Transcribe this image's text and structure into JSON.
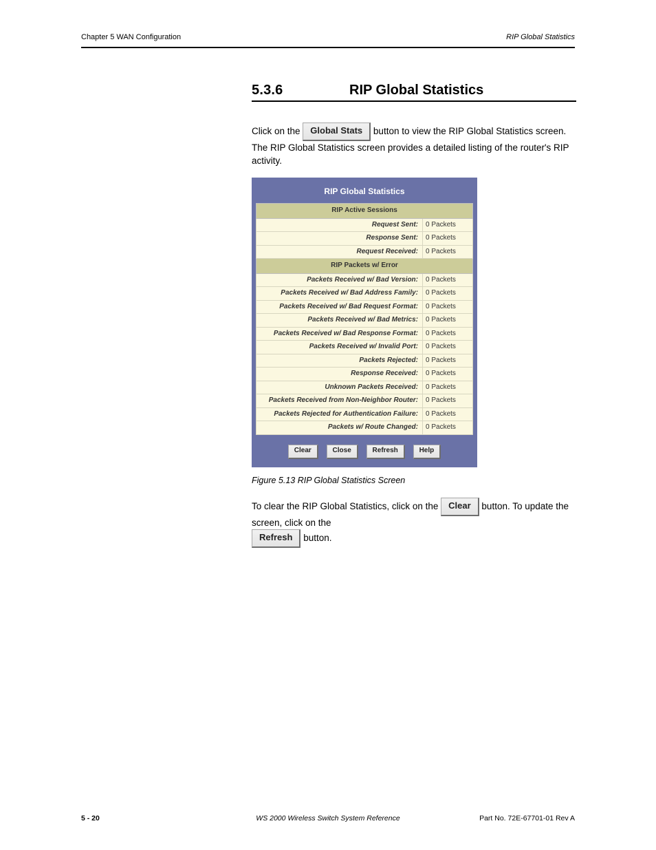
{
  "header": {
    "left": "Chapter 5    WAN Configuration",
    "right": "RIP Global Statistics"
  },
  "section": {
    "number": "5.3.6",
    "title": "RIP Global Statistics"
  },
  "para1_prefix": "Click on the ",
  "para1_btn": "Global Stats",
  "para1_suffix": " button to view the RIP Global Statistics screen. The RIP Global Statistics screen provides a detailed listing of the router's RIP activity.",
  "panel": {
    "title": "RIP Global Statistics",
    "section1": "RIP Active Sessions",
    "rows1": [
      {
        "label": "Request Sent:",
        "value": "0 Packets"
      },
      {
        "label": "Response Sent:",
        "value": "0 Packets"
      },
      {
        "label": "Request Received:",
        "value": "0 Packets"
      }
    ],
    "section2": "RIP Packets w/ Error",
    "rows2": [
      {
        "label": "Packets Received w/ Bad Version:",
        "value": "0 Packets"
      },
      {
        "label": "Packets Received w/ Bad Address Family:",
        "value": "0 Packets"
      },
      {
        "label": "Packets Received w/ Bad Request Format:",
        "value": "0 Packets"
      },
      {
        "label": "Packets Received w/ Bad Metrics:",
        "value": "0 Packets"
      },
      {
        "label": "Packets Received w/ Bad Response Format:",
        "value": "0 Packets"
      },
      {
        "label": "Packets Received w/ Invalid Port:",
        "value": "0 Packets"
      },
      {
        "label": "Packets Rejected:",
        "value": "0 Packets"
      },
      {
        "label": "Response Received:",
        "value": "0 Packets"
      },
      {
        "label": "Unknown Packets Received:",
        "value": "0 Packets"
      },
      {
        "label": "Packets Received from Non-Neighbor Router:",
        "value": "0 Packets"
      },
      {
        "label": "Packets Rejected for Authentication Failure:",
        "value": "0 Packets"
      },
      {
        "label": "Packets w/ Route Changed:",
        "value": "0 Packets"
      }
    ],
    "buttons": {
      "clear": "Clear",
      "close": "Close",
      "refresh": "Refresh",
      "help": "Help"
    }
  },
  "fig_label": "Figure 5.13    RIP Global Statistics Screen",
  "para2_a": "To clear the RIP Global Statistics, click on the ",
  "para2_btn1": "Clear",
  "para2_b": " button. To update the screen, click on the ",
  "para2_btn2": "Refresh",
  "para2_c": " button.",
  "footer": {
    "page": "5 - 20",
    "mid": "WS 2000 Wireless Switch System Reference",
    "right": "Part No. 72E-67701-01  Rev A"
  }
}
